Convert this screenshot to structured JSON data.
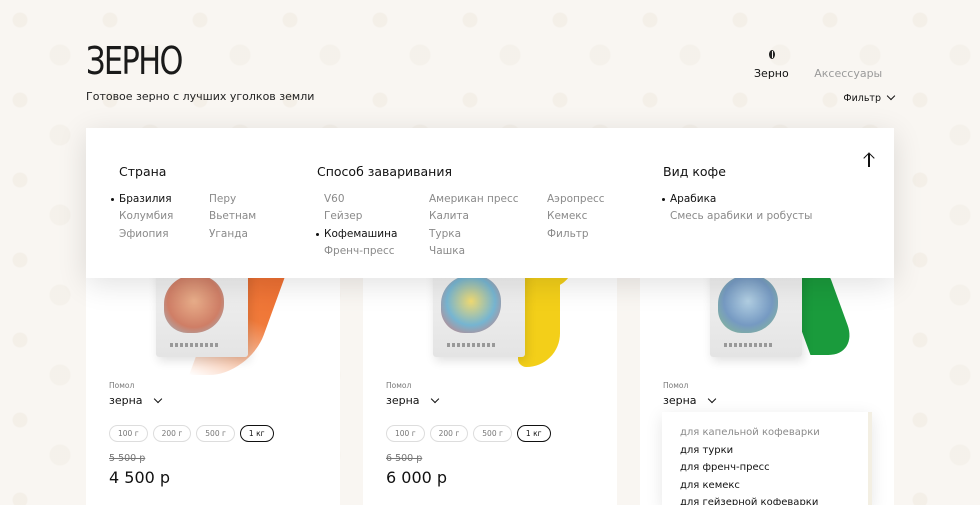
{
  "header": {
    "title": "ЗЕРНО",
    "subtitle": "Готовое зерно с лучших уголков земли"
  },
  "nav": {
    "icon": "coffee-bean-icon",
    "tabs": [
      {
        "label": "Зерно",
        "active": true
      },
      {
        "label": "Аксессуары",
        "active": false
      }
    ],
    "filter_label": "Фильтр"
  },
  "filters": {
    "country": {
      "title": "Страна",
      "col1": [
        {
          "label": "Бразилия",
          "active": true
        },
        {
          "label": "Колумбия",
          "active": false
        },
        {
          "label": "Эфиопия",
          "active": false
        }
      ],
      "col2": [
        {
          "label": "Перу",
          "active": false
        },
        {
          "label": "Вьетнам",
          "active": false
        },
        {
          "label": "Уганда",
          "active": false
        }
      ]
    },
    "brew": {
      "title": "Способ заваривания",
      "col1": [
        {
          "label": "V60",
          "active": false
        },
        {
          "label": "Гейзер",
          "active": false
        },
        {
          "label": "Кофемашина",
          "active": true
        },
        {
          "label": "Френч-пресс",
          "active": false
        }
      ],
      "col2": [
        {
          "label": "Американ пресс",
          "active": false
        },
        {
          "label": "Калита",
          "active": false
        },
        {
          "label": "Турка",
          "active": false
        },
        {
          "label": "Чашка",
          "active": false
        }
      ],
      "col3": [
        {
          "label": "Аэропресс",
          "active": false
        },
        {
          "label": "Кемекс",
          "active": false
        },
        {
          "label": "Фильтр",
          "active": false
        }
      ]
    },
    "coffee_type": {
      "title": "Вид кофе",
      "col1": [
        {
          "label": "Арабика",
          "active": true
        },
        {
          "label": "Смесь арабики и робусты",
          "active": false
        }
      ]
    },
    "collapse_icon": "arrow-up-icon"
  },
  "products": [
    {
      "accent": "#ed6a2e",
      "grind_label": "Помол",
      "grind_value": "зерна",
      "weights": [
        "100 г",
        "200 г",
        "500 г",
        "1 кг"
      ],
      "selected_weight": "1 кг",
      "old_price": "5 500 р",
      "price": "4 500 р"
    },
    {
      "accent": "#f3cf19",
      "grind_label": "Помол",
      "grind_value": "зерна",
      "weights": [
        "100 г",
        "200 г",
        "500 г",
        "1 кг"
      ],
      "selected_weight": "1 кг",
      "old_price": "6 500 р",
      "price": "6 000 р"
    },
    {
      "accent": "#1a9b3c",
      "grind_label": "Помол",
      "grind_value": "зерна",
      "grind_options": [
        "для капельной кофеварки",
        "для турки",
        "для френч-пресс",
        "для кемекс",
        "для гейзерной кофеварки"
      ]
    }
  ]
}
